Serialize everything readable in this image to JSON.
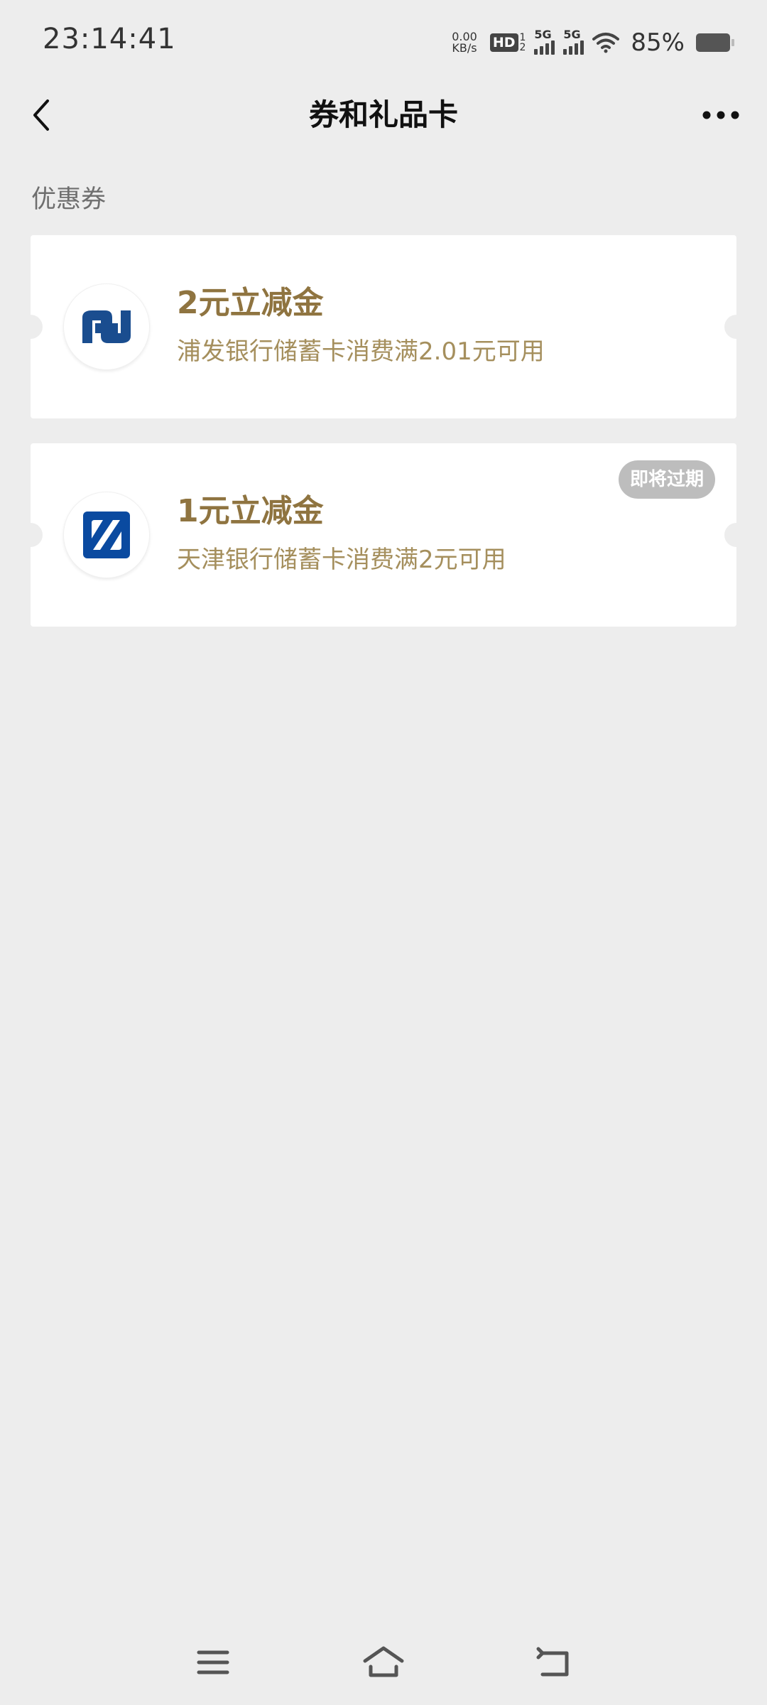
{
  "status_bar": {
    "time": "23:14:41",
    "net_speed_value": "0.00",
    "net_speed_unit": "KB/s",
    "hd_label": "HD",
    "hd_sim_top": "1",
    "hd_sim_bottom": "2",
    "signal1_label": "5G",
    "signal2_label": "5G",
    "battery": "85%"
  },
  "header": {
    "title": "券和礼品卡"
  },
  "section": {
    "label": "优惠券"
  },
  "coupons": [
    {
      "title": "2元立减金",
      "description": "浦发银行储蓄卡消费满2.01元可用",
      "bank_logo": "spdb-logo"
    },
    {
      "title": "1元立减金",
      "description": "天津银行储蓄卡消费满2元可用",
      "bank_logo": "tianjin-bank-logo",
      "badge": "即将过期"
    }
  ],
  "colors": {
    "background": "#ededed",
    "card": "#ffffff",
    "coupon_title": "#8f7440",
    "coupon_desc": "#a58f5d",
    "badge_bg": "#bdbdbd",
    "spdb_blue": "#1a4d8f",
    "tianjin_blue": "#0a4aa0"
  },
  "icons": {
    "back": "chevron-left-icon",
    "more": "more-dots-icon",
    "wifi": "wifi-icon",
    "battery": "battery-icon",
    "sys_menu": "menu-lines-icon",
    "sys_home": "home-icon",
    "sys_back": "return-icon"
  }
}
